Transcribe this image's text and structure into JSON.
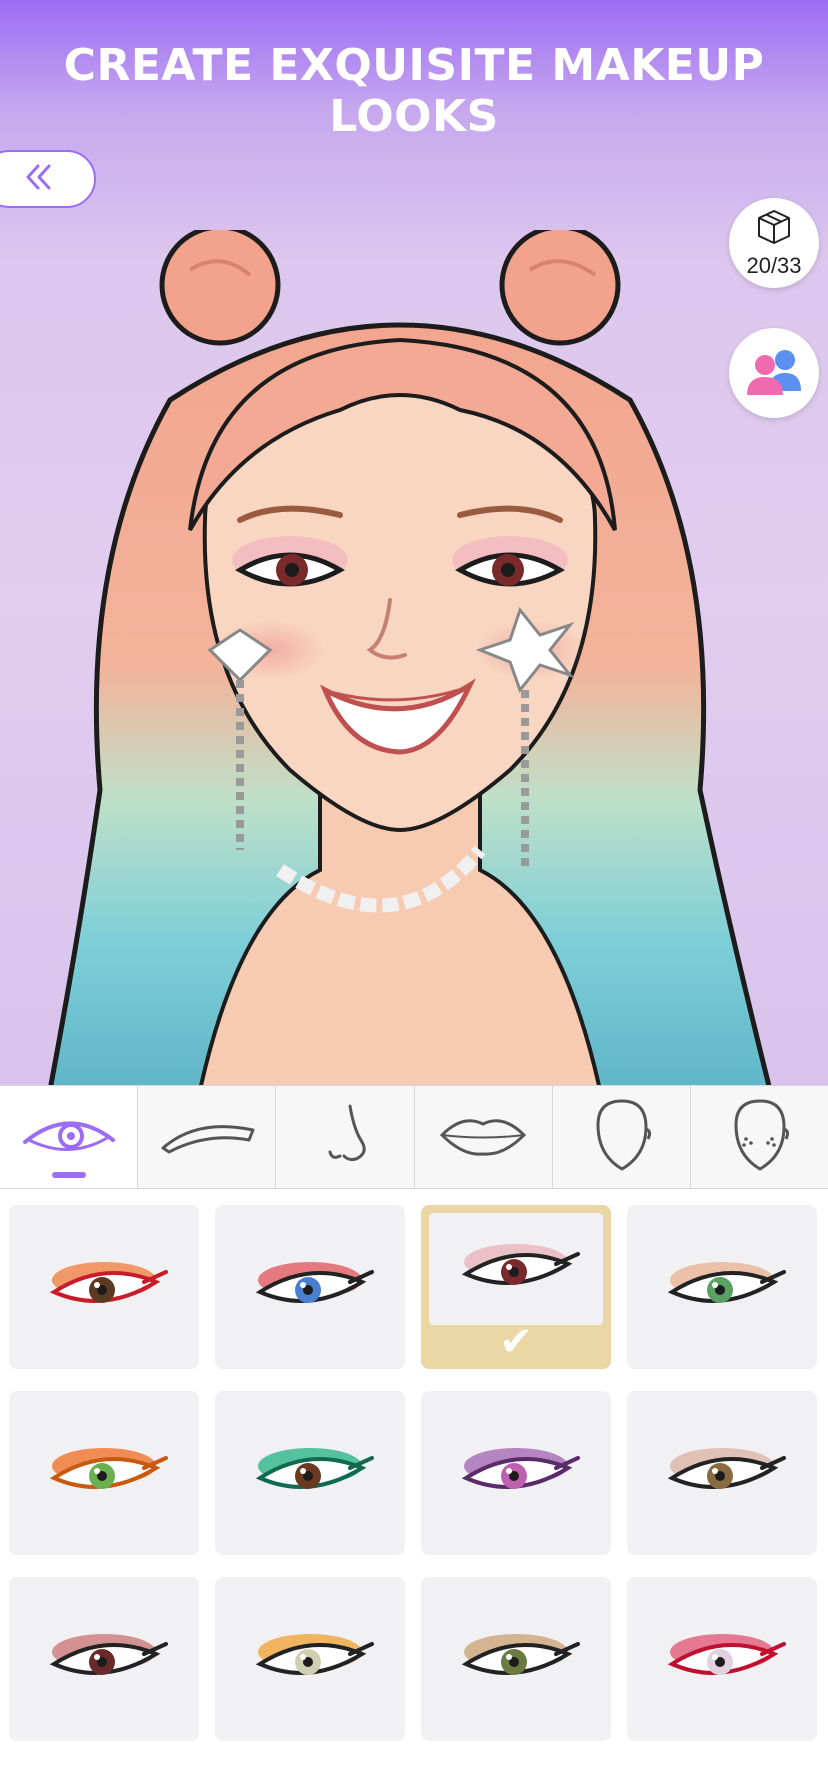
{
  "header": {
    "title": "CREATE EXQUISITE MAKEUP LOOKS"
  },
  "progress": {
    "label": "20/33"
  },
  "colors": {
    "accent": "#9d6cf4",
    "selected": "#ead7a4"
  },
  "tabs": [
    {
      "name": "eyes",
      "icon": "eye-icon",
      "active": true
    },
    {
      "name": "brows",
      "icon": "eyebrow-icon"
    },
    {
      "name": "nose",
      "icon": "nose-icon"
    },
    {
      "name": "lips",
      "icon": "lips-icon"
    },
    {
      "name": "face",
      "icon": "face-shape-icon"
    },
    {
      "name": "freckles",
      "icon": "freckles-face-icon"
    }
  ],
  "eye_styles": [
    {
      "shadow": "#f07a3a",
      "iris": "#5a3a20",
      "liner": "#c81c2a"
    },
    {
      "shadow": "#e0505a",
      "iris": "#4a7fd0",
      "liner": "#222"
    },
    {
      "shadow": "#e8b0b8",
      "iris": "#7a2a2a",
      "liner": "#222",
      "selected": true
    },
    {
      "shadow": "#e8b090",
      "iris": "#5aa060",
      "liner": "#222"
    },
    {
      "shadow": "#f06a20",
      "iris": "#6ab050",
      "liner": "#c85a10"
    },
    {
      "shadow": "#20b080",
      "iris": "#6a3a20",
      "liner": "#0f6a50"
    },
    {
      "shadow": "#a060b0",
      "iris": "#c060b0",
      "liner": "#5a2a6a"
    },
    {
      "shadow": "#d8b0a0",
      "iris": "#8a6a40",
      "liner": "#222"
    },
    {
      "shadow": "#c87070",
      "iris": "#6a2a2a",
      "liner": "#222"
    },
    {
      "shadow": "#f0a030",
      "iris": "#d0d0b0",
      "liner": "#222"
    },
    {
      "shadow": "#c8a070",
      "iris": "#6a7a40",
      "liner": "#222"
    },
    {
      "shadow": "#e05070",
      "iris": "#e0d0e0",
      "liner": "#c01030"
    }
  ]
}
